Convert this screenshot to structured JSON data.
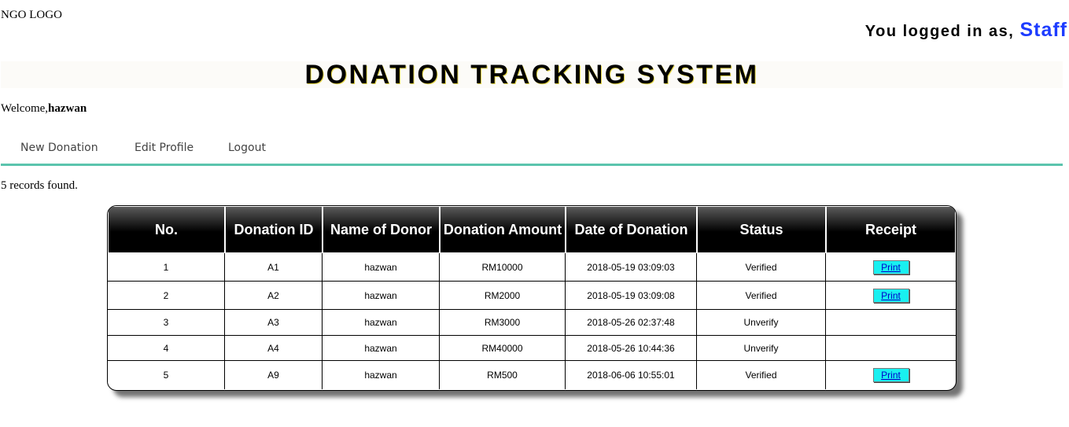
{
  "header": {
    "logo_text": "NGO LOGO",
    "login_prefix": "You logged in as,",
    "login_role": "Staff"
  },
  "banner": {
    "title": "DONATION TRACKING SYSTEM"
  },
  "welcome": {
    "prefix": "Welcome,",
    "username": "hazwan"
  },
  "nav": {
    "items": [
      "New Donation",
      "Edit Profile",
      "Logout"
    ]
  },
  "records_text": "5 records found.",
  "colors": {
    "nav_underline": "#5bc4ad",
    "role_text": "#1d3cff",
    "print_button": "#19f0f0"
  },
  "table": {
    "columns": [
      "No.",
      "Donation ID",
      "Name of Donor",
      "Donation Amount",
      "Date of Donation",
      "Status",
      "Receipt"
    ],
    "rows": [
      {
        "no": "1",
        "id": "A1",
        "donor": "hazwan",
        "amount": "RM10000",
        "date": "2018-05-19 03:09:03",
        "status": "Verified",
        "receipt": "Print"
      },
      {
        "no": "2",
        "id": "A2",
        "donor": "hazwan",
        "amount": "RM2000",
        "date": "2018-05-19 03:09:08",
        "status": "Verified",
        "receipt": "Print"
      },
      {
        "no": "3",
        "id": "A3",
        "donor": "hazwan",
        "amount": "RM3000",
        "date": "2018-05-26 02:37:48",
        "status": "Unverify",
        "receipt": ""
      },
      {
        "no": "4",
        "id": "A4",
        "donor": "hazwan",
        "amount": "RM40000",
        "date": "2018-05-26 10:44:36",
        "status": "Unverify",
        "receipt": ""
      },
      {
        "no": "5",
        "id": "A9",
        "donor": "hazwan",
        "amount": "RM500",
        "date": "2018-06-06 10:55:01",
        "status": "Verified",
        "receipt": "Print"
      }
    ]
  }
}
